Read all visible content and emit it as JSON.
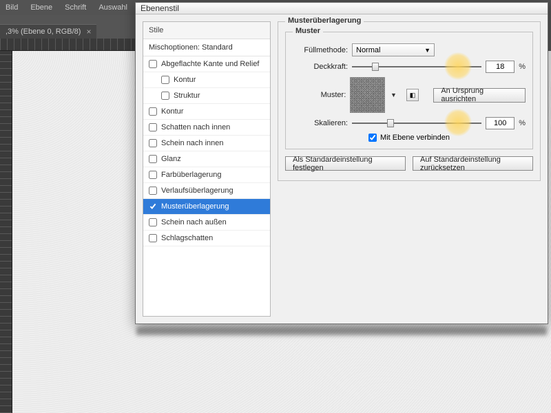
{
  "menubar": {
    "items": [
      "Bild",
      "Ebene",
      "Schrift",
      "Auswahl"
    ]
  },
  "doctab": {
    "label": ",3% (Ebene 0, RGB/8)",
    "close": "×"
  },
  "dialog": {
    "title": "Ebenenstil",
    "left": {
      "header": "Stile",
      "mixOptions": "Mischoptionen: Standard",
      "items": [
        {
          "label": "Abgeflachte Kante und Relief",
          "checked": false,
          "sub": false
        },
        {
          "label": "Kontur",
          "checked": false,
          "sub": true
        },
        {
          "label": "Struktur",
          "checked": false,
          "sub": true
        },
        {
          "label": "Kontur",
          "checked": false,
          "sub": false
        },
        {
          "label": "Schatten nach innen",
          "checked": false,
          "sub": false
        },
        {
          "label": "Schein nach innen",
          "checked": false,
          "sub": false
        },
        {
          "label": "Glanz",
          "checked": false,
          "sub": false
        },
        {
          "label": "Farbüberlagerung",
          "checked": false,
          "sub": false
        },
        {
          "label": "Verlaufsüberlagerung",
          "checked": false,
          "sub": false
        },
        {
          "label": "Musterüberlagerung",
          "checked": true,
          "sub": false,
          "selected": true
        },
        {
          "label": "Schein nach außen",
          "checked": false,
          "sub": false
        },
        {
          "label": "Schlagschatten",
          "checked": false,
          "sub": false
        }
      ]
    },
    "right": {
      "groupTitle": "Musterüberlagerung",
      "innerTitle": "Muster",
      "fillMode": {
        "label": "Füllmethode:",
        "value": "Normal"
      },
      "opacity": {
        "label": "Deckkraft:",
        "value": "18",
        "pct": "%"
      },
      "patternLabel": "Muster:",
      "snapOrigin": "An Ursprung ausrichten",
      "scale": {
        "label": "Skalieren:",
        "value": "100",
        "pct": "%"
      },
      "linkLayer": "Mit Ebene verbinden",
      "setDefault": "Als Standardeinstellung festlegen",
      "resetDefault": "Auf Standardeinstellung zurücksetzen"
    }
  }
}
